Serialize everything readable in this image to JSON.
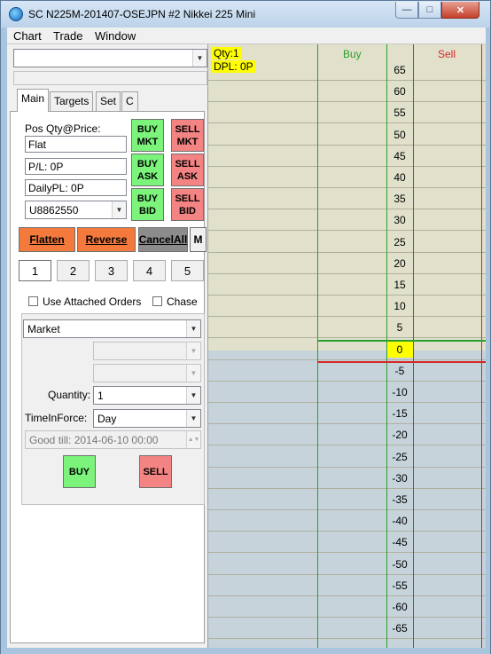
{
  "window": {
    "title": "SC N225M-201407-OSEJPN  #2  Nikkei 225 Mini",
    "min_glyph": "—",
    "max_glyph": "□",
    "close_glyph": "✕"
  },
  "menu": {
    "items": [
      "Chart",
      "Trade",
      "Window"
    ]
  },
  "left_panel": {
    "symbol_combo_value": "",
    "tabs": [
      "Main",
      "Targets",
      "Set",
      "C"
    ],
    "active_tab": "Main",
    "pos_label": "Pos Qty@Price:",
    "pos_value": "Flat",
    "pl_value": "P/L: 0P",
    "daily_pl_value": "DailyPL: 0P",
    "account": "U8862550",
    "buy_mkt": "BUY\nMKT",
    "sell_mkt": "SELL\nMKT",
    "buy_ask": "BUY\nASK",
    "sell_ask": "SELL\nASK",
    "buy_bid": "BUY\nBID",
    "sell_bid": "SELL\nBID",
    "flatten": "Flatten",
    "reverse": "Reverse",
    "cancel_all": "CancelAll",
    "m_label": "M",
    "qty_buttons": [
      "1",
      "2",
      "3",
      "4",
      "5"
    ],
    "selected_qty_button": "1",
    "use_attached_orders": "Use Attached Orders",
    "chase": "Chase",
    "order_type": "Market",
    "quantity_label": "Quantity:",
    "quantity_value": "1",
    "tif_label": "TimeInForce:",
    "tif_value": "Day",
    "good_till": "Good till: 2014-06-10 00:00",
    "buy_button": "BUY",
    "sell_button": "SELL"
  },
  "ladder": {
    "qty_label": "Qty:1",
    "dpl_label": "DPL: 0P",
    "buy_header": "Buy",
    "sell_header": "Sell",
    "prices": [
      "65",
      "60",
      "55",
      "50",
      "45",
      "40",
      "35",
      "30",
      "25",
      "20",
      "15",
      "10",
      "5",
      "0",
      "-5",
      "-10",
      "-15",
      "-20",
      "-25",
      "-30",
      "-35",
      "-40",
      "-45",
      "-50",
      "-55",
      "-60",
      "-65"
    ],
    "current_price": "0"
  },
  "colors": {
    "ladder_upper_bg": "#e0e0cb",
    "ladder_lower_bg": "#c6d3db",
    "buy_color": "#2ca02c",
    "sell_color": "#d62728",
    "current_price_bg": "#ffff00"
  }
}
